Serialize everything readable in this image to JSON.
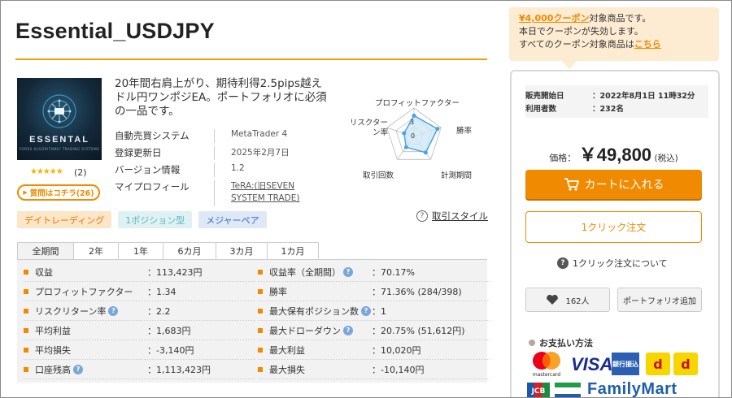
{
  "product": {
    "title": "Essential_USDJPY",
    "description": "20年間右肩上がり、期待利得2.5pips越えドル円ワンポジEA。ポートフォリオに必須の一品です。",
    "image": {
      "logo_word": "ESSENTAL",
      "logo_sub": "FOREX ALGORITHMIC TRADING SYSTEMS",
      "colors": {
        "bg": "#13293a",
        "accent": "#3aa8d8"
      }
    },
    "rating_stars": "★★★★★",
    "rating_count": "(2)",
    "qa_button": "質問はコチラ(26)",
    "qa_icon": "play-triangle-icon"
  },
  "info": [
    {
      "label": "自動売買システム",
      "value": "MetaTrader 4"
    },
    {
      "label": "登録更新日",
      "value": "2025年2月7日"
    },
    {
      "label": "バージョン情報",
      "value": "1.2"
    },
    {
      "label": "マイプロフィール",
      "value": "TeRA:(旧SEVEN SYSTEM TRADE)"
    }
  ],
  "radar": {
    "labels": {
      "profit_factor": "プロフィットファクター",
      "win_rate": "勝率",
      "period": "計測期間",
      "trades": "取引回数",
      "risk_return": "リスクターン率"
    },
    "scale_labels": [
      "3",
      "0"
    ],
    "values": [
      2.2,
      2.6,
      2.1,
      1.4,
      1.1
    ],
    "max": 3,
    "colors": {
      "fill": "#cfe8f7",
      "line": "#4aa3df",
      "point": "#4aa3df",
      "grid": "#bbbbbb"
    }
  },
  "tags": [
    "デイトレーディング",
    "1ポジション型",
    "メジャーペア"
  ],
  "trade_style_link": "取引スタイル",
  "tabs": [
    "全期間",
    "2年",
    "1年",
    "6カ月",
    "3カ月",
    "1カ月"
  ],
  "active_tab": 0,
  "stats_left": [
    {
      "label": "収益",
      "value": "：113,423円",
      "help": false
    },
    {
      "label": "プロフィットファクター",
      "value": "：1.34",
      "help": false
    },
    {
      "label": "リスクリターン率",
      "value": "：2.2",
      "help": true
    },
    {
      "label": "平均利益",
      "value": "：1,683円",
      "help": false
    },
    {
      "label": "平均損失",
      "value": "：-3,140円",
      "help": false
    },
    {
      "label": "口座残高",
      "value": "：1,113,423円",
      "help": true
    }
  ],
  "stats_right": [
    {
      "label": "収益率（全期間）",
      "value": "：70.17%",
      "help": true
    },
    {
      "label": "勝率",
      "value": "：71.36% (284/398)",
      "help": false
    },
    {
      "label": "最大保有ポジション数",
      "value": "：1",
      "help": true
    },
    {
      "label": "最大ドローダウン",
      "value": "：20.75% (51,612円)",
      "help": true
    },
    {
      "label": "最大利益",
      "value": "：10,020円",
      "help": false
    },
    {
      "label": "最大損失",
      "value": "：-10,140円",
      "help": false
    }
  ],
  "help_glyph": "?",
  "coupon": {
    "amount": "¥4,000クーポン",
    "line1_rest": "対象商品です。",
    "line2": "本日でクーポンが失効します。",
    "line3_prefix": "すべてのクーポン対象商品は",
    "line3_link": "こちら"
  },
  "sale": {
    "start_label": "販売開始日",
    "start_value": "：2022年8月1日 11時32分",
    "users_label": "利用者数",
    "users_value": "：232名"
  },
  "price": {
    "label": "価格：",
    "value": "￥49,800",
    "tax": "(税込)"
  },
  "buttons": {
    "cart": "カートに入れる",
    "cart_icon": "cart-icon",
    "oneclick": "1クリック注文",
    "oneclick_help": "1クリック注文について",
    "fav_count": "162人",
    "portfolio": "ポートフォリオ追加"
  },
  "payment": {
    "title": "お支払い方法",
    "mastercard": "mastercard",
    "visa": "VISA",
    "bank": "銀行振込",
    "d1": "d",
    "d2": "d",
    "jcb": "JCB",
    "familymart": "FamilyMart"
  },
  "colors": {
    "accent": "#f08a00",
    "coupon_bg": "#fdebd2"
  }
}
